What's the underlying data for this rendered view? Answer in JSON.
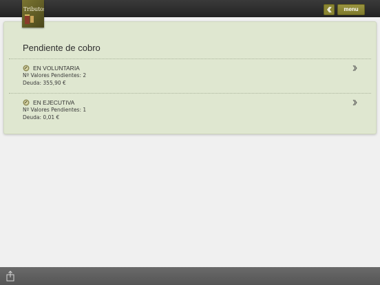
{
  "app": {
    "logo_text": "Tributos"
  },
  "header": {
    "menu_label": "menu",
    "back_icon": "chevron-left-icon"
  },
  "panel": {
    "title": "Pendiente de cobro",
    "items": [
      {
        "name": "EN VOLUNTARIA",
        "pending_line": "Nº Valores Pendientes: 2",
        "debt_line": "Deuda: 355,90 €",
        "icon": "coin-icon"
      },
      {
        "name": "EN EJECUTIVA",
        "pending_line": "Nº Valores Pendientes: 1",
        "debt_line": "Deuda: 0,01 €",
        "icon": "coin-icon"
      }
    ]
  },
  "footer": {
    "share_icon": "share-icon"
  },
  "colors": {
    "accent": "#7e7a2c",
    "panel_bg": "#dfe7d0",
    "topbar": "#2a2a2a",
    "bottombar": "#5f5f5f"
  }
}
